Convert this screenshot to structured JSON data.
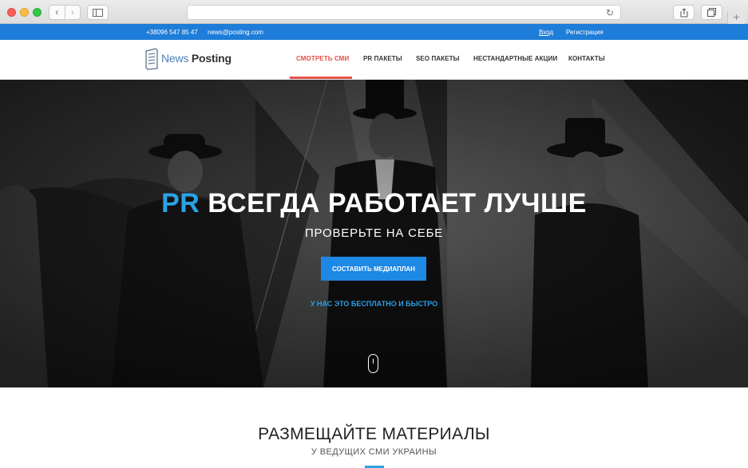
{
  "browser": {
    "back_icon": "chevron-left-icon",
    "forward_icon": "chevron-right-icon",
    "reload_icon": "reload-icon"
  },
  "topbar": {
    "phone": "+38096 547 85 47",
    "email": "news@posting.com",
    "login": "Вход",
    "register": "Регистрация",
    "color": "#1e7dd8"
  },
  "logo": {
    "news": "News",
    "posting": "Posting"
  },
  "menu": [
    {
      "label": "СМОТРЕТЬ СМИ",
      "active": true
    },
    {
      "label": "PR ПАКЕТЫ"
    },
    {
      "label": "SEO ПАКЕТЫ"
    },
    {
      "label": "НЕСТАНДАРТНЫЕ АКЦИИ"
    },
    {
      "label": "КОНТАКТЫ"
    }
  ],
  "hero": {
    "title_accent": "PR",
    "title_rest": "ВСЕГДА РАБОТАЕТ ЛУЧШЕ",
    "subtitle": "ПРОВЕРЬТЕ НА СЕБЕ",
    "cta_label": "СОСТАВИТЬ МЕДИАПЛАН",
    "note": "У НАС ЭТО БЕСПЛАТНО И БЫСТРО",
    "accent_color": "#2aa3e6",
    "button_color": "#1e88e5"
  },
  "section": {
    "title": "РАЗМЕЩАЙТЕ МАТЕРИАЛЫ",
    "subtitle": "У ВЕДУЩИХ СМИ УКРАИНЫ"
  }
}
